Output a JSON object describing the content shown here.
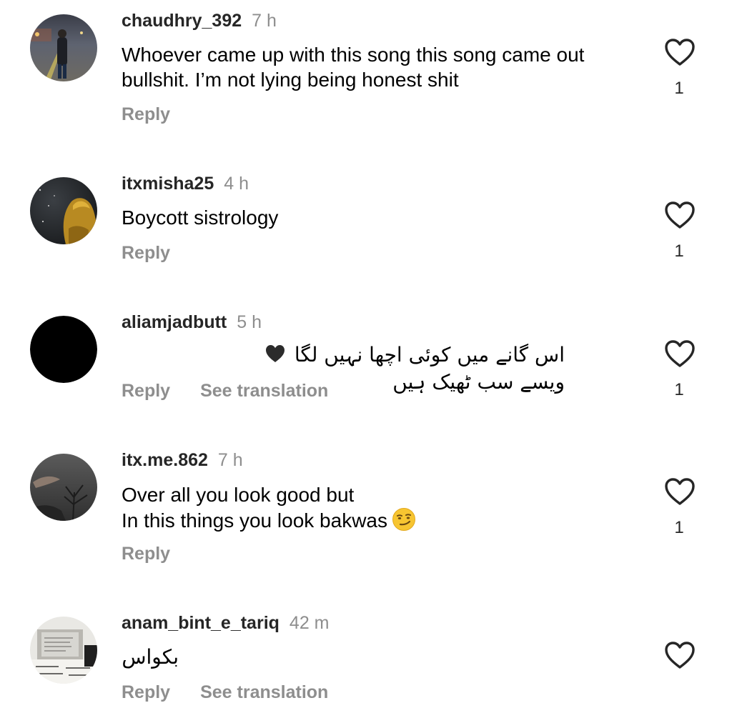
{
  "comments": [
    {
      "username": "chaudhry_392",
      "time": "7 h",
      "text_lines": [
        "Whoever came up with this song this song came out",
        "bullshit. I’m not lying being honest shit"
      ],
      "reply_label": "Reply",
      "likes": "1",
      "avatar": "night-street-photo"
    },
    {
      "username": "itxmisha25",
      "time": "4 h",
      "text_lines": [
        "Boycott sistrology"
      ],
      "reply_label": "Reply",
      "likes": "1",
      "avatar": "yellow-hood-photo"
    },
    {
      "username": "aliamjadbutt",
      "time": "5 h",
      "text_rtl_part1": "اس گانے میں کوئی اچھا نہیں لگا",
      "text_rtl_part2": "ویسے سب ٹھیک ہیں",
      "emoji": "black-heart",
      "reply_label": "Reply",
      "translate_label": "See translation",
      "likes": "1",
      "avatar": "black-circle"
    },
    {
      "username": "itx.me.862",
      "time": "7 h",
      "text_lines": [
        "Over all you look good but",
        "In this things you look bakwas"
      ],
      "emoji": "smirking-face",
      "reply_label": "Reply",
      "likes": "1",
      "avatar": "dark-hand-tree-photo"
    },
    {
      "username": "anam_bint_e_tariq",
      "time": "42 m",
      "text_rtl_part1": "بکواس",
      "reply_label": "Reply",
      "translate_label": "See translation",
      "avatar": "book-page-photo"
    }
  ],
  "icons": {
    "like": "heart-outline-icon"
  },
  "colors": {
    "username": "#262626",
    "secondary": "#8e8e8e",
    "text": "#000000"
  }
}
